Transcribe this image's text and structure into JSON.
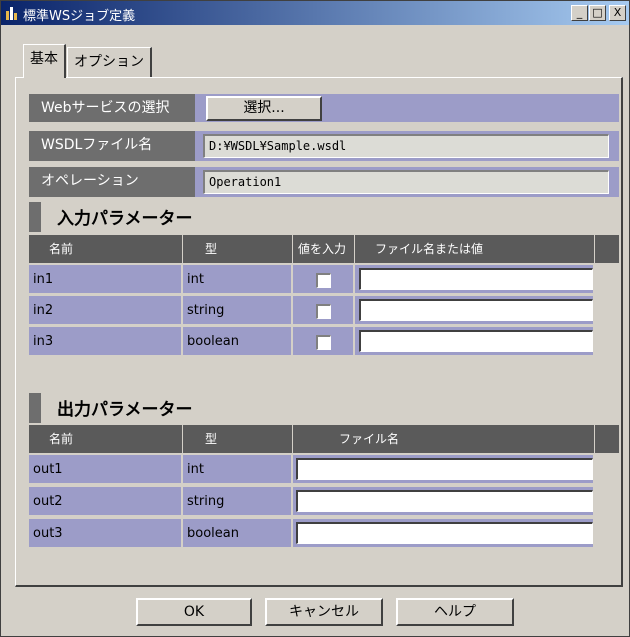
{
  "window": {
    "title": "標準WSジョブ定義",
    "minimize": "_",
    "maximize": "□",
    "close": "X"
  },
  "tabs": [
    {
      "label": "基本",
      "active": true
    },
    {
      "label": "オプション",
      "active": false
    }
  ],
  "basic": {
    "web_service_label": "Webサービスの選択",
    "select_button": "選択...",
    "wsdl_label": "WSDLファイル名",
    "wsdl_value": "D:¥WSDL¥Sample.wsdl",
    "operation_label": "オペレーション",
    "operation_value": "Operation1"
  },
  "input_params": {
    "title": "入力パラメーター",
    "columns": [
      "名前",
      "型",
      "値を入力",
      "ファイル名または値"
    ],
    "rows": [
      {
        "name": "in1",
        "type": "int",
        "checked": false,
        "value": ""
      },
      {
        "name": "in2",
        "type": "string",
        "checked": false,
        "value": ""
      },
      {
        "name": "in3",
        "type": "boolean",
        "checked": false,
        "value": ""
      }
    ]
  },
  "output_params": {
    "title": "出力パラメーター",
    "columns": [
      "名前",
      "型",
      "ファイル名"
    ],
    "rows": [
      {
        "name": "out1",
        "type": "int",
        "value": ""
      },
      {
        "name": "out2",
        "type": "string",
        "value": ""
      },
      {
        "name": "out3",
        "type": "boolean",
        "value": ""
      }
    ]
  },
  "footer": {
    "ok": "OK",
    "cancel": "キャンセル",
    "help": "ヘルプ"
  }
}
